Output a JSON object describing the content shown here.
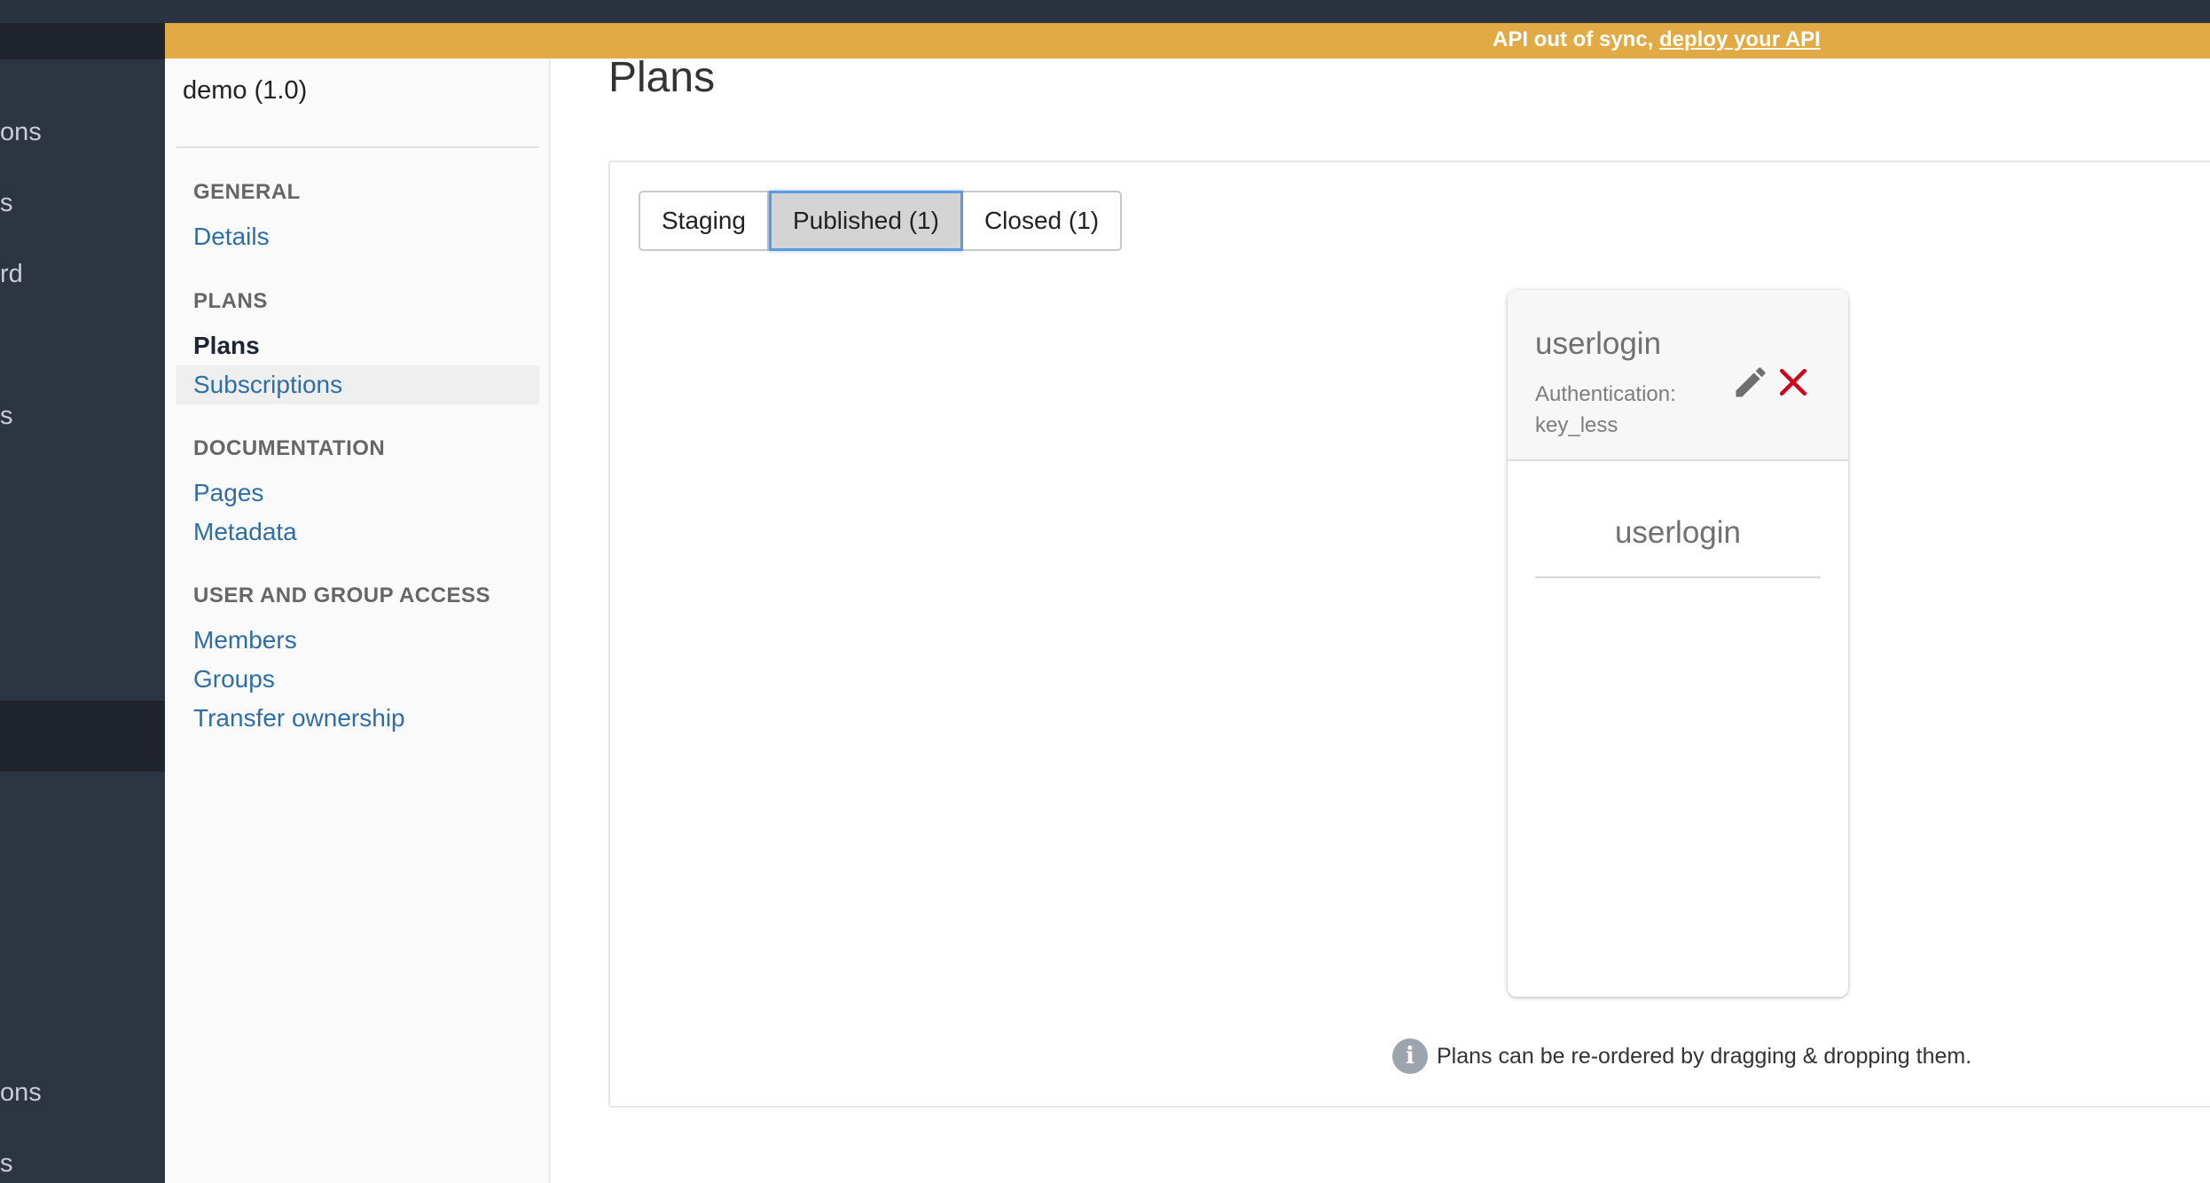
{
  "left_nav": {
    "items": [
      "ons",
      "s",
      "rd",
      "s",
      "ons",
      "s"
    ]
  },
  "banner": {
    "text": "API out of sync, ",
    "link": "deploy your API"
  },
  "secondary_nav": {
    "api_name": "demo (1.0)",
    "sections": {
      "general": {
        "heading": "GENERAL",
        "links": [
          "Details"
        ]
      },
      "plans": {
        "heading": "PLANS",
        "links": [
          "Plans",
          "Subscriptions"
        ],
        "active": "Plans"
      },
      "documentation": {
        "heading": "DOCUMENTATION",
        "links": [
          "Pages",
          "Metadata"
        ]
      },
      "access": {
        "heading": "USER AND GROUP ACCESS",
        "links": [
          "Members",
          "Groups",
          "Transfer ownership"
        ]
      }
    }
  },
  "main": {
    "title": "Plans",
    "tabs": [
      "Staging",
      "Published (1)",
      "Closed (1)"
    ],
    "selected_tab": "Published (1)",
    "plan": {
      "name": "userlogin",
      "auth_label": "Authentication:",
      "auth_value": "key_less",
      "body_title": "userlogin",
      "edit_icon": "pencil-icon",
      "delete_icon": "close-icon"
    },
    "hint": {
      "icon": "info-icon",
      "icon_glyph": "i",
      "text": "Plans can be re-ordered by dragging & dropping them."
    }
  },
  "colors": {
    "banner": "#e2aa45",
    "dark_nav": "#2e3542",
    "link": "#2e6ea6",
    "delete": "#d0021b",
    "tab_focus": "#5a9ae3"
  }
}
